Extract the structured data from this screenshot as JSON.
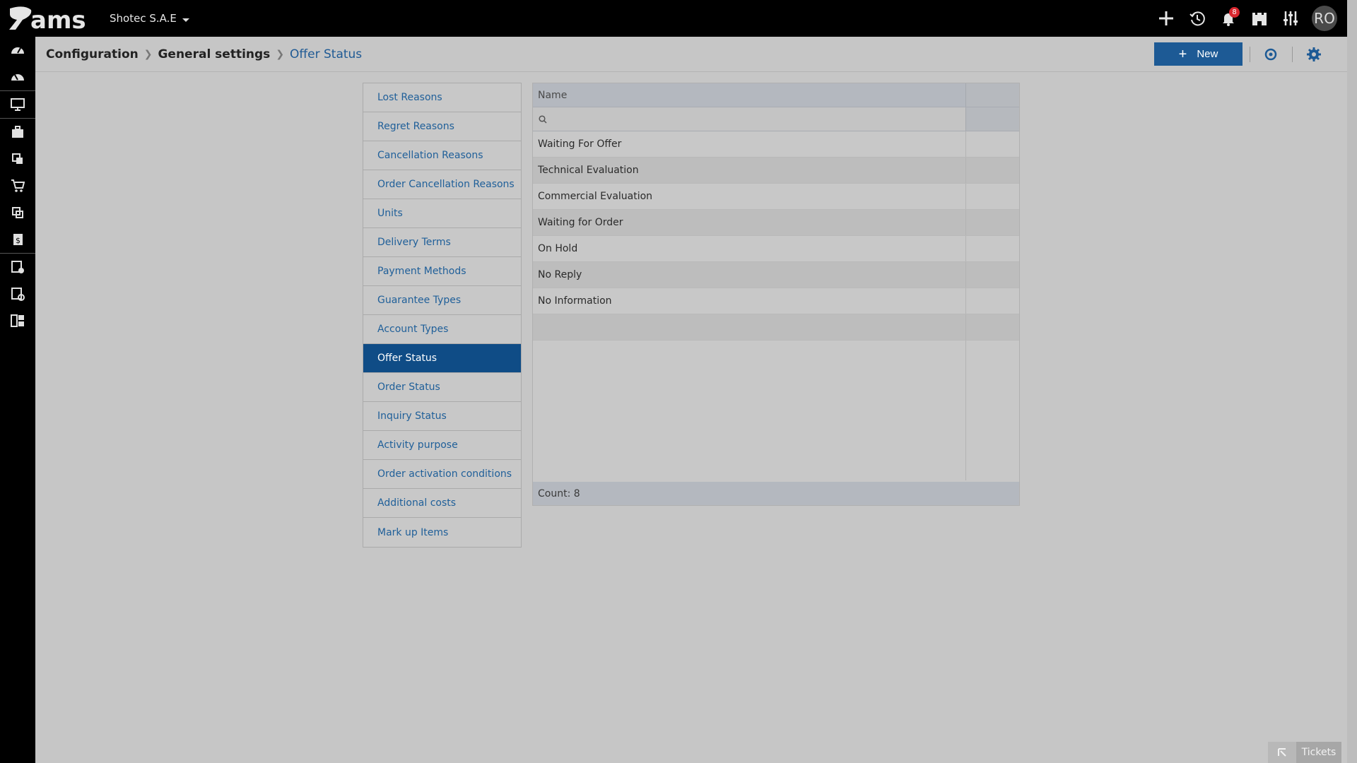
{
  "brand": {
    "logo_text": "ams"
  },
  "topbar": {
    "company": "Shotec S.A.E",
    "notification_count": "8",
    "avatar_initials": "RO"
  },
  "breadcrumb": [
    {
      "label": "Configuration"
    },
    {
      "label": "General settings"
    },
    {
      "label": "Offer Status"
    }
  ],
  "toolbar": {
    "new_label": "New"
  },
  "settings_menu": [
    "Lost Reasons",
    "Regret Reasons",
    "Cancellation Reasons",
    "Order Cancellation Reasons",
    "Units",
    "Delivery Terms",
    "Payment Methods",
    "Guarantee Types",
    "Account Types",
    "Offer Status",
    "Order Status",
    "Inquiry Status",
    "Activity purpose",
    "Order activation conditions",
    "Additional costs",
    "Mark up Items"
  ],
  "active_menu": "Offer Status",
  "grid": {
    "column_name": "Name",
    "filter_value": "",
    "rows": [
      "Waiting For Offer",
      "Technical Evaluation",
      "Commercial Evaluation",
      "Waiting for Order",
      "On Hold",
      "No Reply",
      "No Information",
      ""
    ],
    "count_text": "Count: 8"
  },
  "tickets": {
    "label": "Tickets"
  }
}
